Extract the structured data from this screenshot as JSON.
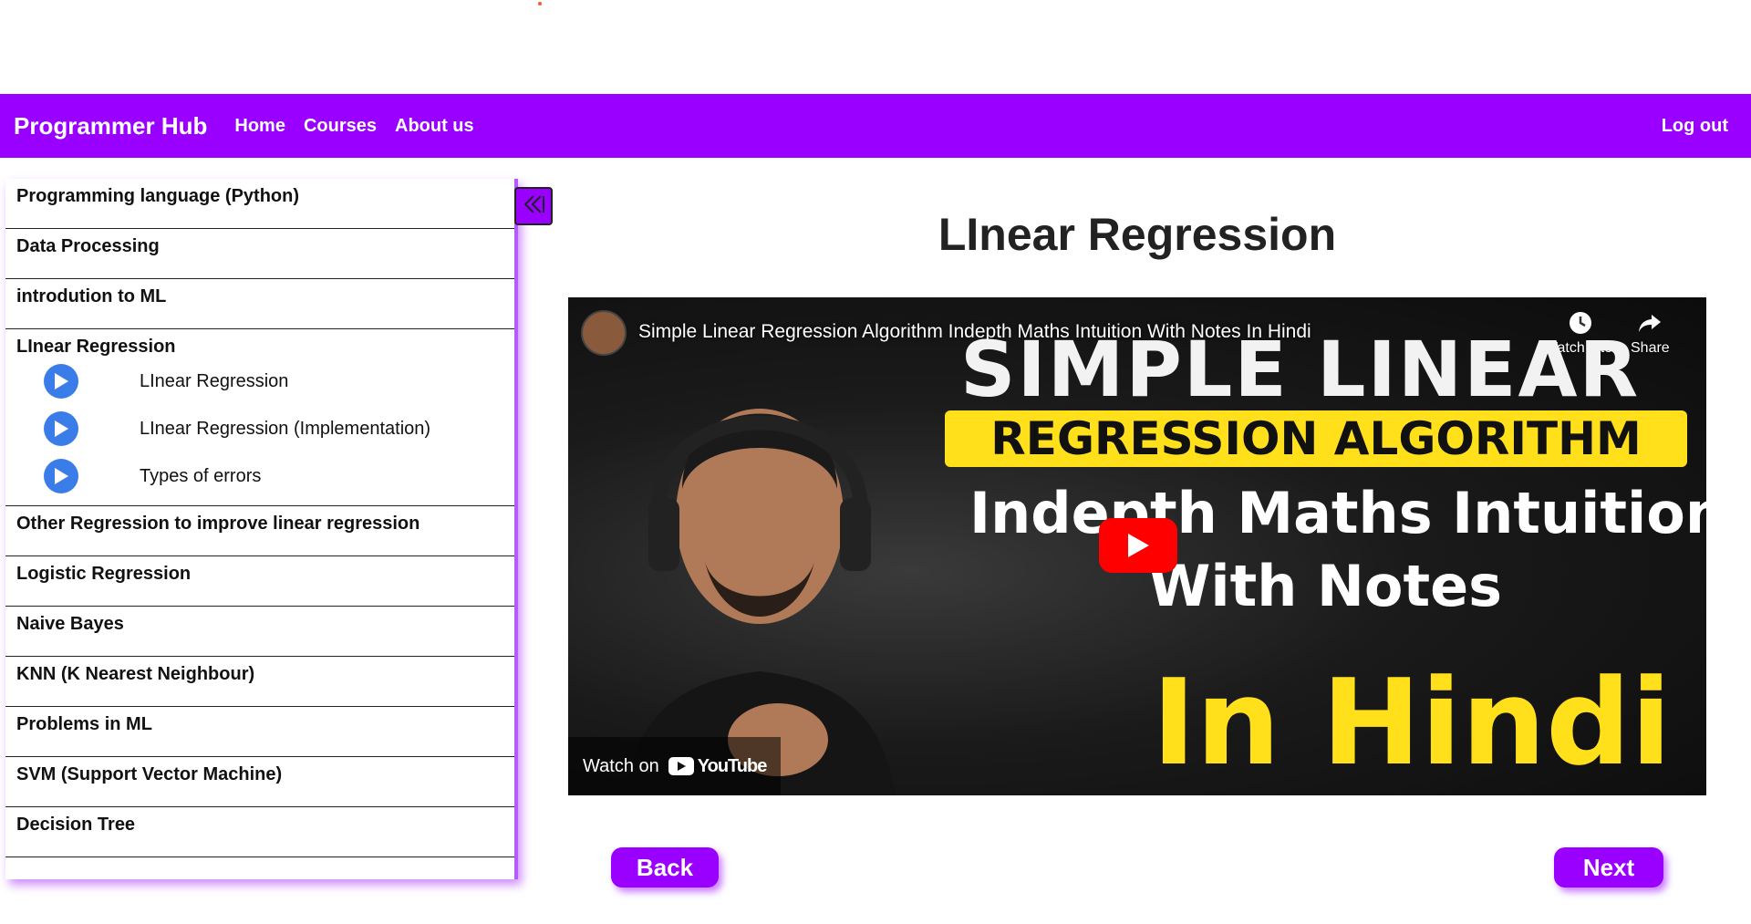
{
  "navbar": {
    "brand": "Programmer Hub",
    "links": [
      "Home",
      "Courses",
      "About us"
    ],
    "logout": "Log out",
    "color": "#9900ff"
  },
  "sidebar": {
    "sections": [
      {
        "title": "Programming language (Python)"
      },
      {
        "title": "Data Processing"
      },
      {
        "title": "introdution to ML"
      },
      {
        "title": "LInear Regression",
        "items": [
          "LInear Regression",
          "LInear Regression (Implementation)",
          "Types of errors"
        ]
      },
      {
        "title": "Other Regression to improve linear regression"
      },
      {
        "title": "Logistic Regression"
      },
      {
        "title": "Naive Bayes"
      },
      {
        "title": "KNN (K Nearest Neighbour)"
      },
      {
        "title": "Problems in ML"
      },
      {
        "title": "SVM (Support Vector Machine)"
      },
      {
        "title": "Decision Tree"
      }
    ],
    "collapse_icon": "double-chevron-left-icon"
  },
  "main": {
    "title": "LInear Regression"
  },
  "video": {
    "title": "Simple Linear Regression Algorithm Indepth Maths Intuition With Notes In Hindi",
    "watch_later": "Watch later",
    "share": "Share",
    "watch_on": "Watch on",
    "youtube": "YouTube",
    "thumb_line1": "SIMPLE LINEAR",
    "thumb_line2": "REGRESSION ALGORITHM",
    "thumb_line3": "Indepth Maths Intuition",
    "thumb_line4": "With Notes",
    "thumb_line5": "In Hindi"
  },
  "buttons": {
    "back": "Back",
    "next": "Next"
  }
}
